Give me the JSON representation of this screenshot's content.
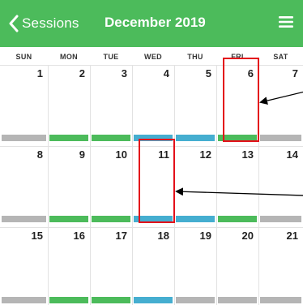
{
  "header": {
    "back_label": "Sessions",
    "title": "December 2019",
    "icons": {
      "back": "chevron-left-icon",
      "menu": "hamburger-menu-icon"
    }
  },
  "weekdays": [
    "SUN",
    "MON",
    "TUE",
    "WED",
    "THU",
    "FRI",
    "SAT"
  ],
  "weeks": [
    {
      "days": [
        "1",
        "2",
        "3",
        "4",
        "5",
        "6",
        "7"
      ],
      "bars": [
        "gray",
        "green",
        "green",
        "blue",
        "blue",
        "green",
        "gray"
      ]
    },
    {
      "days": [
        "8",
        "9",
        "10",
        "11",
        "12",
        "13",
        "14"
      ],
      "bars": [
        "gray",
        "green",
        "green",
        "blue",
        "blue",
        "green",
        "gray"
      ]
    },
    {
      "days": [
        "15",
        "16",
        "17",
        "18",
        "19",
        "20",
        "21"
      ],
      "bars": [
        "gray",
        "green",
        "green",
        "blue",
        "gray",
        "gray",
        "gray"
      ]
    }
  ],
  "colors": {
    "header_bg": "#4cbb5b",
    "gray": "#b5b5b5",
    "green": "#4cbb5b",
    "blue": "#45aed0",
    "annotation": "#e3101a"
  }
}
